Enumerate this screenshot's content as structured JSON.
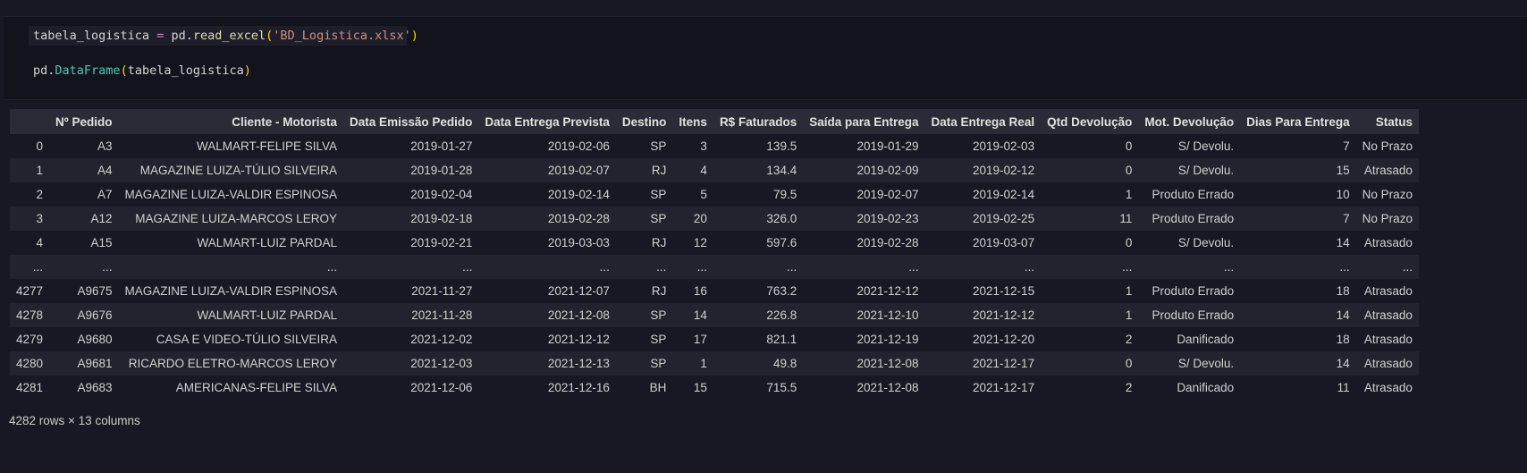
{
  "code": {
    "line1": {
      "var": "tabela_logistica",
      "op": "=",
      "mod": "pd",
      "fn": "read_excel",
      "arg": "'BD_Logistica.xlsx'"
    },
    "line2": {
      "mod": "pd",
      "fn": "DataFrame",
      "arg": "tabela_logistica"
    }
  },
  "table": {
    "columns": [
      "",
      "Nº Pedido",
      "Cliente - Motorista",
      "Data Emissão Pedido",
      "Data Entrega Prevista",
      "Destino",
      "Itens",
      "R$ Faturados",
      "Saída para Entrega",
      "Data Entrega Real",
      "Qtd Devolução",
      "Mot. Devolução",
      "Dias Para Entrega",
      "Status"
    ],
    "rows": [
      [
        "0",
        "A3",
        "WALMART-FELIPE SILVA",
        "2019-01-27",
        "2019-02-06",
        "SP",
        "3",
        "139.5",
        "2019-01-29",
        "2019-02-03",
        "0",
        "S/ Devolu.",
        "7",
        "No Prazo"
      ],
      [
        "1",
        "A4",
        "MAGAZINE LUIZA-TÚLIO SILVEIRA",
        "2019-01-28",
        "2019-02-07",
        "RJ",
        "4",
        "134.4",
        "2019-02-09",
        "2019-02-12",
        "0",
        "S/ Devolu.",
        "15",
        "Atrasado"
      ],
      [
        "2",
        "A7",
        "MAGAZINE LUIZA-VALDIR ESPINOSA",
        "2019-02-04",
        "2019-02-14",
        "SP",
        "5",
        "79.5",
        "2019-02-07",
        "2019-02-14",
        "1",
        "Produto Errado",
        "10",
        "No Prazo"
      ],
      [
        "3",
        "A12",
        "MAGAZINE LUIZA-MARCOS LEROY",
        "2019-02-18",
        "2019-02-28",
        "SP",
        "20",
        "326.0",
        "2019-02-23",
        "2019-02-25",
        "11",
        "Produto Errado",
        "7",
        "No Prazo"
      ],
      [
        "4",
        "A15",
        "WALMART-LUIZ PARDAL",
        "2019-02-21",
        "2019-03-03",
        "RJ",
        "12",
        "597.6",
        "2019-02-28",
        "2019-03-07",
        "0",
        "S/ Devolu.",
        "14",
        "Atrasado"
      ],
      [
        "...",
        "...",
        "...",
        "...",
        "...",
        "...",
        "...",
        "...",
        "...",
        "...",
        "...",
        "...",
        "...",
        "..."
      ],
      [
        "4277",
        "A9675",
        "MAGAZINE LUIZA-VALDIR ESPINOSA",
        "2021-11-27",
        "2021-12-07",
        "RJ",
        "16",
        "763.2",
        "2021-12-12",
        "2021-12-15",
        "1",
        "Produto Errado",
        "18",
        "Atrasado"
      ],
      [
        "4278",
        "A9676",
        "WALMART-LUIZ PARDAL",
        "2021-11-28",
        "2021-12-08",
        "SP",
        "14",
        "226.8",
        "2021-12-10",
        "2021-12-12",
        "1",
        "Produto Errado",
        "14",
        "Atrasado"
      ],
      [
        "4279",
        "A9680",
        "CASA E VIDEO-TÚLIO SILVEIRA",
        "2021-12-02",
        "2021-12-12",
        "SP",
        "17",
        "821.1",
        "2021-12-19",
        "2021-12-20",
        "2",
        "Danificado",
        "18",
        "Atrasado"
      ],
      [
        "4280",
        "A9681",
        "RICARDO ELETRO-MARCOS LEROY",
        "2021-12-03",
        "2021-12-13",
        "SP",
        "1",
        "49.8",
        "2021-12-08",
        "2021-12-17",
        "0",
        "S/ Devolu.",
        "14",
        "Atrasado"
      ],
      [
        "4281",
        "A9683",
        "AMERICANAS-FELIPE SILVA",
        "2021-12-06",
        "2021-12-16",
        "BH",
        "15",
        "715.5",
        "2021-12-08",
        "2021-12-17",
        "2",
        "Danificado",
        "11",
        "Atrasado"
      ]
    ]
  },
  "shape_info": "4282 rows × 13 columns",
  "colors": {
    "background": "#181824",
    "header_bg": "#2b2b37",
    "stripe_bg": "#232330",
    "code_bg": "#13131d"
  }
}
